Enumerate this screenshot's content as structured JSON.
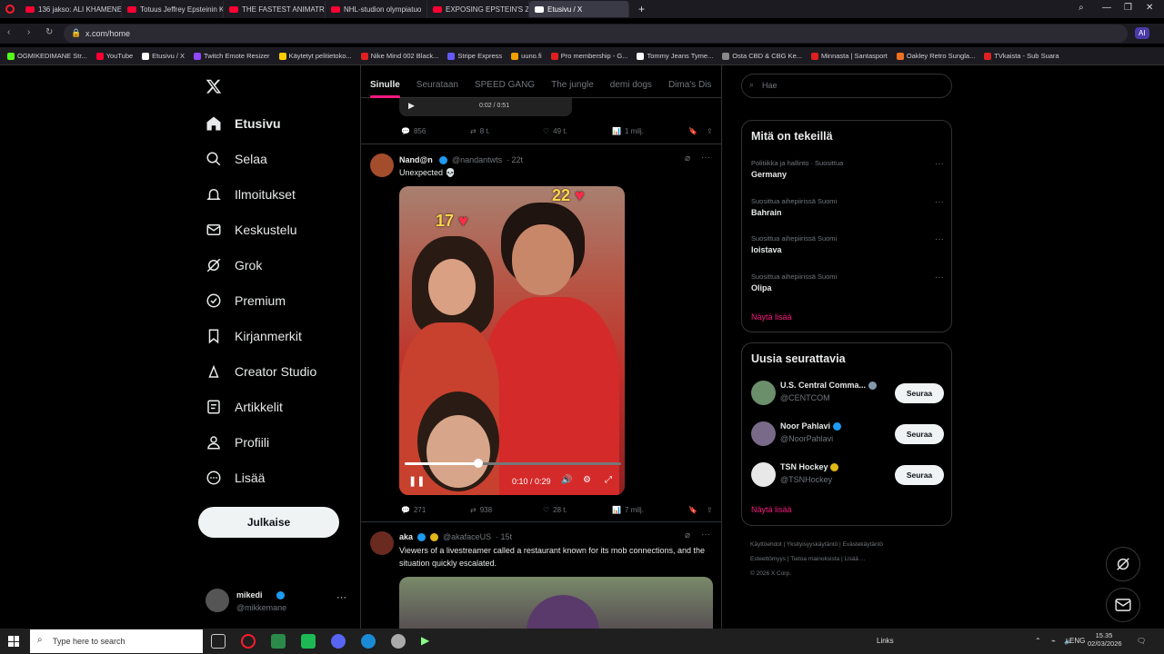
{
  "browser": {
    "tabs": [
      {
        "label": "136 jakso: ALI KHAMENEI",
        "color": "#ff0033"
      },
      {
        "label": "Totuus Jeffrey Epsteinin K",
        "color": "#ff0033"
      },
      {
        "label": "THE FASTEST ANIMATRON",
        "color": "#ff0033"
      },
      {
        "label": "NHL-studion olympiatuo",
        "color": "#ff0033"
      },
      {
        "label": "EXPOSING EPSTEIN'S ZOR",
        "color": "#ff0033"
      },
      {
        "label": "Etusivu / X",
        "color": "#ffffff",
        "active": true
      }
    ],
    "url": "x.com/home",
    "bookmarks": [
      {
        "label": "OGMIKEDIMANE Str...",
        "color": "#53fc18"
      },
      {
        "label": "YouTube",
        "color": "#ff0033"
      },
      {
        "label": "Etusivu / X",
        "color": "#ffffff"
      },
      {
        "label": "Twitch Emote Resizer",
        "color": "#9146ff"
      },
      {
        "label": "Käytetyt pelitietoko...",
        "color": "#ffcc00"
      },
      {
        "label": "Nike Mind 002 Black...",
        "color": "#e02020"
      },
      {
        "label": "Stripe Express",
        "color": "#635bff"
      },
      {
        "label": "uuno.fi",
        "color": "#f0a000"
      },
      {
        "label": "Pro membership - G...",
        "color": "#e02020"
      },
      {
        "label": "Tommy Jeans Tyme...",
        "color": "#ffffff"
      },
      {
        "label": "Osta CBD & CBG Ke...",
        "color": "#888888"
      },
      {
        "label": "Minnasta | Santasport",
        "color": "#e02020"
      },
      {
        "label": "Oakley Retro Sungla...",
        "color": "#f07020"
      },
      {
        "label": "TVkaista - Sub Suara",
        "color": "#e02020"
      }
    ],
    "ai_label": "AI"
  },
  "nav": {
    "items": [
      {
        "label": "Etusivu",
        "icon": "home-icon",
        "active": true
      },
      {
        "label": "Selaa",
        "icon": "search-icon"
      },
      {
        "label": "Ilmoitukset",
        "icon": "bell-icon"
      },
      {
        "label": "Keskustelu",
        "icon": "mail-icon"
      },
      {
        "label": "Grok",
        "icon": "grok-icon"
      },
      {
        "label": "Premium",
        "icon": "premium-icon"
      },
      {
        "label": "Kirjanmerkit",
        "icon": "bookmark-icon"
      },
      {
        "label": "Creator Studio",
        "icon": "creator-icon"
      },
      {
        "label": "Artikkelit",
        "icon": "article-icon"
      },
      {
        "label": "Profiili",
        "icon": "profile-icon"
      },
      {
        "label": "Lisää",
        "icon": "more-icon"
      }
    ],
    "post_label": "Julkaise",
    "account": {
      "name": "mikedi",
      "handle": "@mikkemane"
    }
  },
  "feed": {
    "tabs": [
      "Sinulle",
      "Seurataan",
      "SPEED GANG",
      "The jungle",
      "demi dogs",
      "Dima's Dis"
    ],
    "prev_tweet": {
      "video_time": "0:02 / 0:51",
      "replies": "856",
      "reposts": "8 t.",
      "likes": "49 t.",
      "views": "1 milj."
    },
    "tweet1": {
      "name": "Nand@n",
      "handle": "@nandantwts",
      "time": "· 22t",
      "text": "Unexpected 💀",
      "overlay_left": "17",
      "overlay_right": "22",
      "video_time": "0:10 / 0:29",
      "progress": 0.34,
      "replies": "271",
      "reposts": "938",
      "likes": "28 t.",
      "views": "7 milj."
    },
    "tweet2": {
      "name": "aka",
      "handle": "@akafaceUS",
      "time": "· 15t",
      "text": "Viewers of a livestreamer called a restaurant known for its mob connections, and the situation quickly escalated."
    }
  },
  "right": {
    "search_placeholder": "Hae",
    "trends_title": "Mitä on tekeillä",
    "trends": [
      {
        "meta": "Politiikka ja hallinto · Suosittua",
        "name": "Germany"
      },
      {
        "meta": "Suosittua aihepiirissä Suomi",
        "name": "Bahrain"
      },
      {
        "meta": "Suosittua aihepiirissä Suomi",
        "name": "loistava"
      },
      {
        "meta": "Suosittua aihepiirissä Suomi",
        "name": "Olipa"
      }
    ],
    "show_more": "Näytä lisää",
    "follow_title": "Uusia seurattavia",
    "follows": [
      {
        "name": "U.S. Central Comma...",
        "handle": "@CENTCOM",
        "badge": "gray",
        "avatar_color": "#6b8f6a"
      },
      {
        "name": "Noor Pahlavi",
        "handle": "@NoorPahlavi",
        "badge": "blue",
        "avatar_color": "#7a6a8a"
      },
      {
        "name": "TSN Hockey",
        "handle": "@TSNHockey",
        "badge": "gold",
        "avatar_color": "#e8e8e8"
      }
    ],
    "follow_label": "Seuraa",
    "footer": [
      "Käyttöehdot",
      "Yksityisyyskäytäntö",
      "Evästekäytäntö",
      "Esteettömyys",
      "Tietoa mainoksista",
      "Lisää ...",
      "© 2026 X Corp."
    ]
  },
  "taskbar": {
    "search_placeholder": "Type here to search",
    "links": "Links",
    "lang": "ENG",
    "time": "15.35",
    "date": "02/03/2026"
  }
}
